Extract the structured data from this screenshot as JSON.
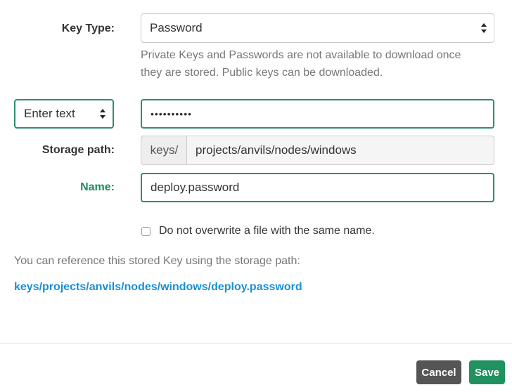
{
  "key_type": {
    "label": "Key Type:",
    "selected": "Password",
    "help": "Private Keys and Passwords are not available to download once they are stored. Public keys can be downloaded."
  },
  "input_mode": {
    "selected": "Enter text"
  },
  "password": {
    "value": "••••••••••"
  },
  "storage_path": {
    "label": "Storage path:",
    "prefix": "keys/",
    "value": "projects/anvils/nodes/windows"
  },
  "name": {
    "label": "Name:",
    "value": "deploy.password"
  },
  "overwrite": {
    "label": "Do not overwrite a file with the same name.",
    "checked": false
  },
  "reference": {
    "text": "You can reference this stored Key using the storage path:",
    "path": "keys/projects/anvils/nodes/windows/deploy.password"
  },
  "footer": {
    "cancel_label": "Cancel",
    "save_label": "Save"
  },
  "colors": {
    "accent": "#21915f",
    "link": "#1a8fd6",
    "cancel": "#555555"
  }
}
